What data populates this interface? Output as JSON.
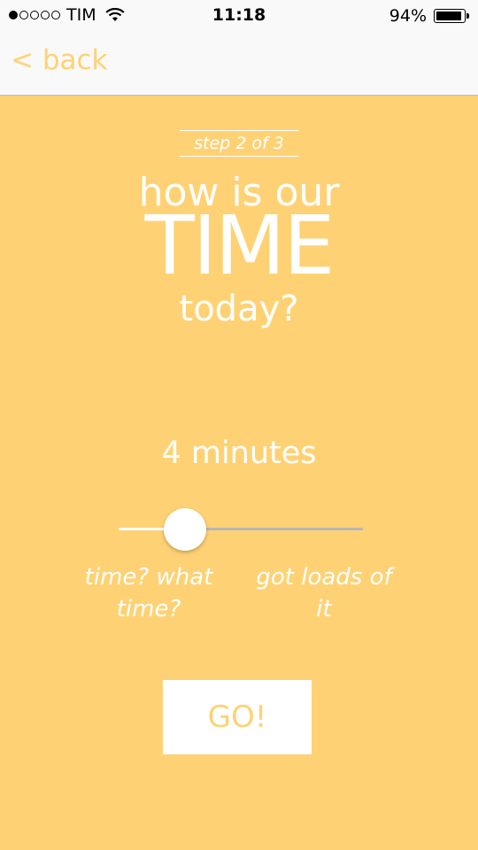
{
  "status_bar": {
    "signal_dots_filled": 1,
    "signal_dots_total": 5,
    "carrier": "TIM",
    "time": "11:18",
    "battery_percent": "94%",
    "battery_level": 0.94,
    "wifi_icon": "wifi-icon",
    "battery_icon": "battery-icon"
  },
  "nav": {
    "back_label": "< back"
  },
  "step": {
    "label": "step 2 of 3"
  },
  "question": {
    "line1": "how is our",
    "line2": "TIME",
    "line3": "today?"
  },
  "slider": {
    "value_label": "4 minutes",
    "position": 0.27,
    "min_label": "time? what time?",
    "max_label": "got loads of it"
  },
  "go_button": {
    "label": "GO!"
  },
  "colors": {
    "accent": "#FED274",
    "background": "#FED274",
    "bar": "#F9F9F9",
    "track": "#B7B7B7"
  }
}
